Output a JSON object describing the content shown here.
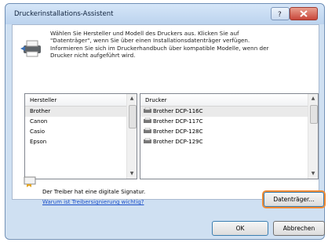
{
  "window": {
    "title": "Druckerinstallations-Assistent"
  },
  "intro": {
    "text": "Wählen Sie Hersteller und Modell des Druckers aus. Klicken Sie auf\n\"Datenträger\", wenn Sie über einen Installationsdatenträger verfügen.\nInformieren Sie sich im Druckerhandbuch über kompatible Modelle, wenn der\nDrucker nicht aufgeführt wird."
  },
  "manufacturer": {
    "header": "Hersteller",
    "items": [
      "Brother",
      "Canon",
      "Casio",
      "Epson"
    ]
  },
  "printers": {
    "header": "Drucker",
    "items": [
      "Brother DCP-116C",
      "Brother DCP-117C",
      "Brother DCP-128C",
      "Brother DCP-129C"
    ]
  },
  "signature": {
    "text": "Der Treiber hat eine digitale Signatur.",
    "link": "Warum ist Treibersignierung wichtig?"
  },
  "buttons": {
    "disk": "Datenträger...",
    "ok": "OK",
    "cancel": "Abbrechen"
  }
}
